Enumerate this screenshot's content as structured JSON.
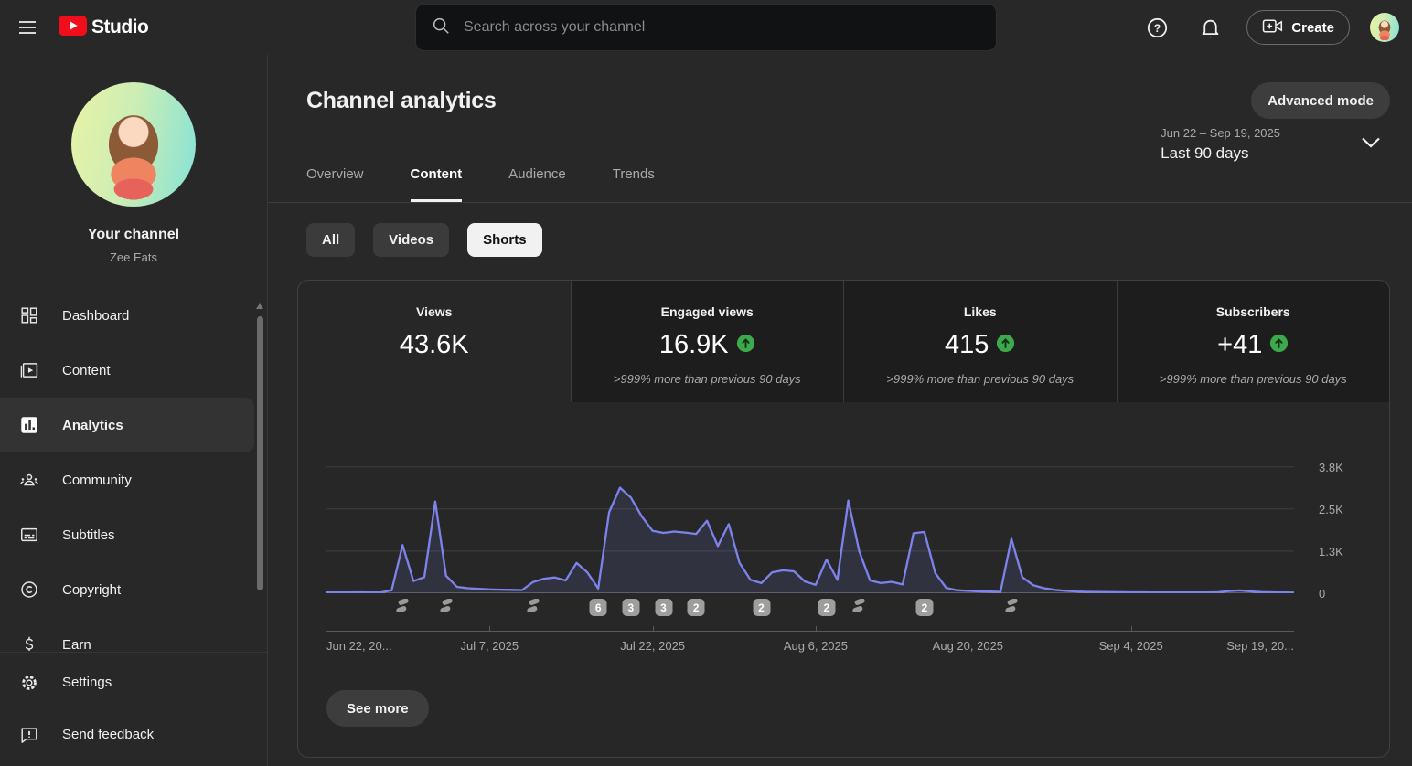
{
  "topbar": {
    "app_name": "Studio",
    "search_placeholder": "Search across your channel",
    "create_label": "Create"
  },
  "sidebar": {
    "channel_title": "Your channel",
    "channel_name": "Zee Eats",
    "items": [
      {
        "label": "Dashboard"
      },
      {
        "label": "Content"
      },
      {
        "label": "Analytics",
        "active": true
      },
      {
        "label": "Community"
      },
      {
        "label": "Subtitles"
      },
      {
        "label": "Copyright"
      },
      {
        "label": "Earn"
      },
      {
        "label": "Settings"
      },
      {
        "label": "Send feedback"
      }
    ]
  },
  "header": {
    "title": "Channel analytics",
    "advanced_mode_label": "Advanced mode",
    "tabs": [
      {
        "label": "Overview"
      },
      {
        "label": "Content",
        "active": true
      },
      {
        "label": "Audience"
      },
      {
        "label": "Trends"
      }
    ],
    "date_range": "Jun 22 – Sep 19, 2025",
    "date_preset": "Last 90 days"
  },
  "filters": [
    {
      "label": "All"
    },
    {
      "label": "Videos"
    },
    {
      "label": "Shorts",
      "active": true
    }
  ],
  "metrics": [
    {
      "label": "Views",
      "value": "43.6K",
      "trend": null,
      "comparison": ""
    },
    {
      "label": "Engaged views",
      "value": "16.9K",
      "trend": "up",
      "comparison": ">999% more than previous 90 days"
    },
    {
      "label": "Likes",
      "value": "415",
      "trend": "up",
      "comparison": ">999% more than previous 90 days"
    },
    {
      "label": "Subscribers",
      "value": "+41",
      "trend": "up",
      "comparison": ">999% more than previous 90 days"
    }
  ],
  "see_more_label": "See more",
  "colors": {
    "line": "#7C84EC",
    "fill": "rgba(124,132,236,0.13)",
    "positive_green": "#3EA84C",
    "badge_gray": "#9E9E9E",
    "selected_chip": "#F1F1F1",
    "youtube_red": "#F20D1A"
  },
  "chart_data": {
    "type": "area",
    "title": "",
    "selected_metric": "Views",
    "xlabel": "",
    "ylabel": "",
    "ymax": 4800,
    "grid": true,
    "line_color": "#7C84EC",
    "fill_color": "rgba(124,132,236,0.13)",
    "y_ticks": [
      {
        "value": 3750,
        "label": "3.8K"
      },
      {
        "value": 2500,
        "label": "2.5K"
      },
      {
        "value": 1250,
        "label": "1.3K"
      },
      {
        "value": 0,
        "label": "0"
      }
    ],
    "x_ticks": [
      {
        "day": 0,
        "label": "Jun 22, 20...",
        "tick": false
      },
      {
        "day": 15,
        "label": "Jul 7, 2025",
        "tick": true
      },
      {
        "day": 30,
        "label": "Jul 22, 2025",
        "tick": true
      },
      {
        "day": 45,
        "label": "Aug 6, 2025",
        "tick": true
      },
      {
        "day": 59,
        "label": "Aug 20, 2025",
        "tick": true
      },
      {
        "day": 74,
        "label": "Sep 4, 2025",
        "tick": true
      },
      {
        "day": 89,
        "label": "Sep 19, 20...",
        "tick": false
      }
    ],
    "series": [
      {
        "name": "Views",
        "values": [
          25,
          22,
          24,
          26,
          23,
          25,
          90,
          1430,
          360,
          480,
          2720,
          520,
          190,
          150,
          130,
          115,
          105,
          100,
          95,
          330,
          430,
          470,
          380,
          900,
          620,
          140,
          2400,
          3130,
          2840,
          2280,
          1850,
          1790,
          1830,
          1800,
          1760,
          2150,
          1400,
          2050,
          900,
          400,
          300,
          620,
          680,
          650,
          350,
          250,
          1000,
          400,
          2750,
          1250,
          380,
          300,
          340,
          260,
          1780,
          1820,
          600,
          160,
          90,
          70,
          55,
          48,
          42,
          1620,
          480,
          240,
          150,
          100,
          70,
          52,
          42,
          36,
          32,
          30,
          28,
          26,
          25,
          24,
          23,
          22,
          22,
          24,
          30,
          65,
          85,
          55,
          32,
          26,
          22,
          20
        ]
      }
    ],
    "markers": [
      {
        "day": 7,
        "type": "shorts"
      },
      {
        "day": 11,
        "type": "shorts"
      },
      {
        "day": 19,
        "type": "shorts"
      },
      {
        "day": 25,
        "type": "count",
        "label": "6"
      },
      {
        "day": 28,
        "type": "count",
        "label": "3"
      },
      {
        "day": 31,
        "type": "count",
        "label": "3"
      },
      {
        "day": 34,
        "type": "count",
        "label": "2"
      },
      {
        "day": 40,
        "type": "count",
        "label": "2"
      },
      {
        "day": 46,
        "type": "count",
        "label": "2"
      },
      {
        "day": 49,
        "type": "shorts"
      },
      {
        "day": 55,
        "type": "count",
        "label": "2"
      },
      {
        "day": 63,
        "type": "shorts"
      }
    ]
  }
}
